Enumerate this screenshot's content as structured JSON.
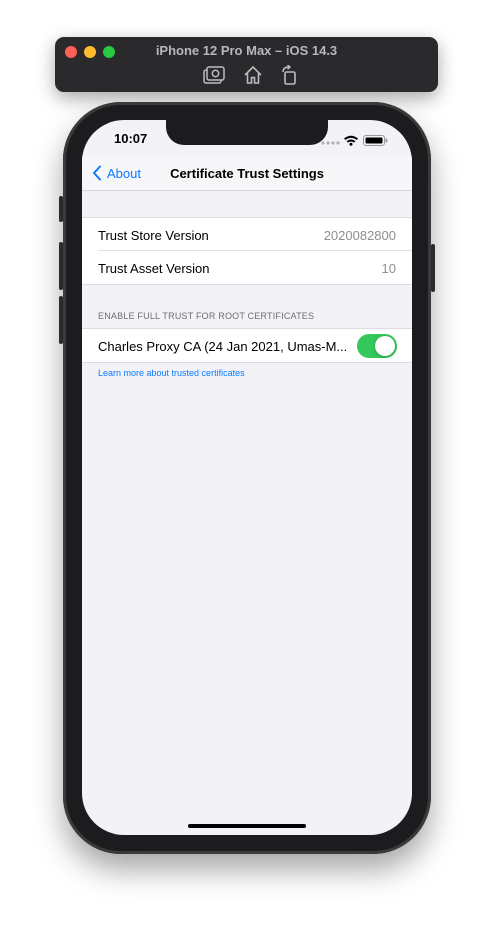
{
  "simulator": {
    "title": "iPhone 12 Pro Max – iOS 14.3",
    "tools": [
      "screenshot-icon",
      "home-icon",
      "rotate-icon"
    ]
  },
  "status_bar": {
    "time": "10:07",
    "icons": [
      "cellular-icon",
      "wifi-icon",
      "battery-icon"
    ]
  },
  "navbar": {
    "back_label": "About",
    "title": "Certificate Trust Settings"
  },
  "info_rows": [
    {
      "label": "Trust Store Version",
      "value": "2020082800"
    },
    {
      "label": "Trust Asset Version",
      "value": "10"
    }
  ],
  "trust_section": {
    "header": "ENABLE FULL TRUST FOR ROOT CERTIFICATES",
    "certificate": {
      "label": "Charles Proxy CA (24 Jan 2021, Umas-M...",
      "enabled": true
    },
    "footer_link": "Learn more about trusted certificates"
  },
  "colors": {
    "accent": "#0A7AFF",
    "toggle_on": "#34C759",
    "background": "#F2F2F7"
  }
}
